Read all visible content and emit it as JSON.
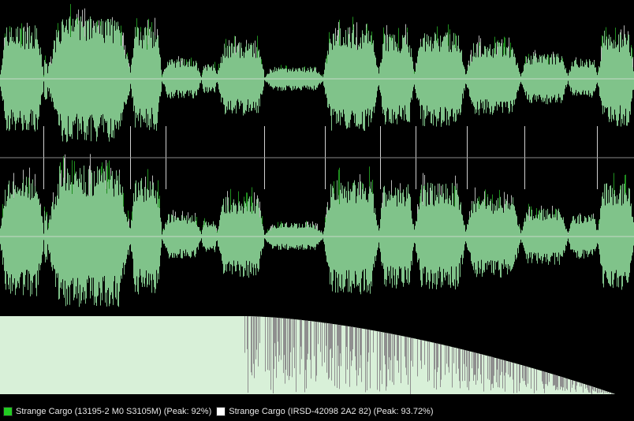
{
  "colors": {
    "background": "#000000",
    "track_a": "#22cc22",
    "track_b": "#ffffff",
    "wave_fill": "#80c38a",
    "wave_overlay": "#b8b8b8",
    "centerline": "#c8d8c8",
    "spectrum_fill": "#d8f0d8"
  },
  "legend": [
    {
      "color": "#22cc22",
      "label": "Strange Cargo (13195-2 M0 S3105M) (Peak: 92%)"
    },
    {
      "color": "#ffffff",
      "label": "Strange Cargo (IRSD-42098 2A2 82) (Peak: 93.72%)"
    }
  ]
}
